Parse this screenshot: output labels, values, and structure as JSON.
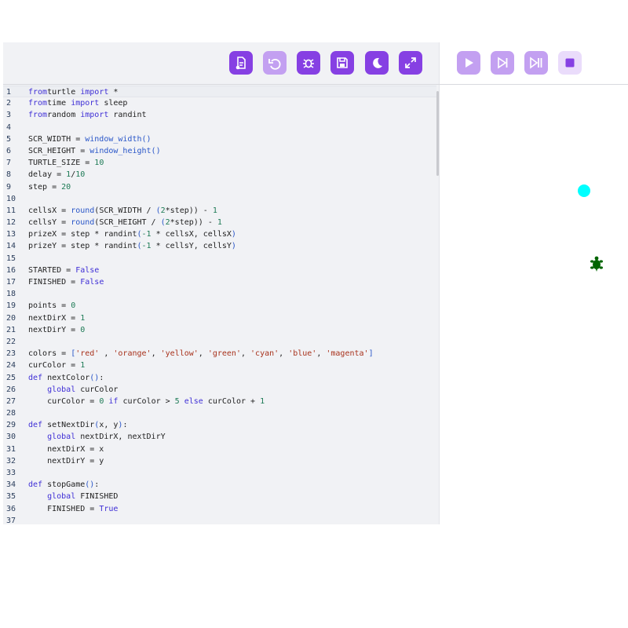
{
  "editor_toolbar": {
    "buttons": [
      {
        "name": "file-icon-button",
        "icon": "file-icon",
        "tone": "dark"
      },
      {
        "name": "undo-button",
        "icon": "undo-icon",
        "tone": "light"
      },
      {
        "name": "debug-button",
        "icon": "bug-icon",
        "tone": "dark"
      },
      {
        "name": "save-button",
        "icon": "save-icon",
        "tone": "dark"
      },
      {
        "name": "theme-button",
        "icon": "moon-icon",
        "tone": "dark"
      },
      {
        "name": "fullscreen-button",
        "icon": "expand-icon",
        "tone": "dark"
      }
    ]
  },
  "run_toolbar": {
    "buttons": [
      {
        "name": "run-button",
        "icon": "play-icon",
        "tone": "light"
      },
      {
        "name": "step-button",
        "icon": "step-icon",
        "tone": "light"
      },
      {
        "name": "continue-button",
        "icon": "step-pause-icon",
        "tone": "light"
      },
      {
        "name": "stop-button",
        "icon": "stop-icon",
        "tone": "pale"
      }
    ]
  },
  "code": {
    "active_line": 1,
    "lines": [
      [
        [
          "kw",
          "from"
        ],
        [
          "",
          "turtle "
        ],
        [
          "kw",
          "import"
        ],
        [
          "",
          " *"
        ]
      ],
      [
        [
          "kw",
          "from"
        ],
        [
          "",
          "time "
        ],
        [
          "kw",
          "import"
        ],
        [
          "",
          " sleep"
        ]
      ],
      [
        [
          "kw",
          "from"
        ],
        [
          "",
          "random "
        ],
        [
          "kw",
          "import"
        ],
        [
          "",
          " randint"
        ]
      ],
      [],
      [
        [
          "",
          "SCR_WIDTH = "
        ],
        [
          "fn",
          "window_width()"
        ]
      ],
      [
        [
          "",
          "SCR_HEIGHT = "
        ],
        [
          "fn",
          "window_height()"
        ]
      ],
      [
        [
          "",
          "TURTLE_SIZE = "
        ],
        [
          "nm",
          "10"
        ]
      ],
      [
        [
          "",
          "delay = "
        ],
        [
          "nm",
          "1"
        ],
        [
          "",
          "/"
        ],
        [
          "nm",
          "10"
        ]
      ],
      [
        [
          "",
          "step = "
        ],
        [
          "nm",
          "20"
        ]
      ],
      [],
      [
        [
          "",
          "cellsX = "
        ],
        [
          "fn",
          "round"
        ],
        [
          "",
          "(SCR_WIDTH / "
        ],
        [
          "fn",
          "("
        ],
        [
          "nm",
          "2"
        ],
        [
          "",
          "*step)) - "
        ],
        [
          "nm",
          "1"
        ]
      ],
      [
        [
          "",
          "cellsY = "
        ],
        [
          "fn",
          "round"
        ],
        [
          "",
          "(SCR_HEIGHT / "
        ],
        [
          "fn",
          "("
        ],
        [
          "nm",
          "2"
        ],
        [
          "",
          "*step)) - "
        ],
        [
          "nm",
          "1"
        ]
      ],
      [
        [
          "",
          "prizeX = step * randint"
        ],
        [
          "fn",
          "("
        ],
        [
          "nm",
          "-1"
        ],
        [
          "",
          " * cellsX, cellsX"
        ],
        [
          "fn",
          ")"
        ]
      ],
      [
        [
          "",
          "prizeY = step * randint"
        ],
        [
          "fn",
          "("
        ],
        [
          "nm",
          "-1"
        ],
        [
          "",
          " * cellsY, cellsY"
        ],
        [
          "fn",
          ")"
        ]
      ],
      [],
      [
        [
          "",
          "STARTED = "
        ],
        [
          "kw",
          "False"
        ]
      ],
      [
        [
          "",
          "FINISHED = "
        ],
        [
          "kw",
          "False"
        ]
      ],
      [],
      [
        [
          "",
          "points = "
        ],
        [
          "nm",
          "0"
        ]
      ],
      [
        [
          "",
          "nextDirX = "
        ],
        [
          "nm",
          "1"
        ]
      ],
      [
        [
          "",
          "nextDirY = "
        ],
        [
          "nm",
          "0"
        ]
      ],
      [],
      [
        [
          "",
          "colors = "
        ],
        [
          "fn",
          "["
        ],
        [
          "st",
          "'red'"
        ],
        [
          "",
          " , "
        ],
        [
          "st",
          "'orange'"
        ],
        [
          "",
          ", "
        ],
        [
          "st",
          "'yellow'"
        ],
        [
          "",
          ", "
        ],
        [
          "st",
          "'green'"
        ],
        [
          "",
          ", "
        ],
        [
          "st",
          "'cyan'"
        ],
        [
          "",
          ", "
        ],
        [
          "st",
          "'blue'"
        ],
        [
          "",
          ", "
        ],
        [
          "st",
          "'magenta'"
        ],
        [
          "fn",
          "]"
        ]
      ],
      [
        [
          "",
          "curColor = "
        ],
        [
          "nm",
          "1"
        ]
      ],
      [
        [
          "kw",
          "def"
        ],
        [
          "",
          " nextColor"
        ],
        [
          "fn",
          "()"
        ],
        [
          "",
          ":"
        ]
      ],
      [
        [
          "",
          "    "
        ],
        [
          "kw",
          "global"
        ],
        [
          "",
          " curColor"
        ]
      ],
      [
        [
          "",
          "    curColor = "
        ],
        [
          "nm",
          "0"
        ],
        [
          "",
          " "
        ],
        [
          "kw",
          "if"
        ],
        [
          "",
          " curColor > "
        ],
        [
          "nm",
          "5"
        ],
        [
          "",
          " "
        ],
        [
          "kw",
          "else"
        ],
        [
          "",
          " curColor + "
        ],
        [
          "nm",
          "1"
        ]
      ],
      [],
      [
        [
          "kw",
          "def"
        ],
        [
          "",
          " setNextDir"
        ],
        [
          "fn",
          "("
        ],
        [
          "",
          "x, y"
        ],
        [
          "fn",
          ")"
        ],
        [
          "",
          ":"
        ]
      ],
      [
        [
          "",
          "    "
        ],
        [
          "kw",
          "global"
        ],
        [
          "",
          " nextDirX, nextDirY"
        ]
      ],
      [
        [
          "",
          "    nextDirX = x"
        ]
      ],
      [
        [
          "",
          "    nextDirY = y"
        ]
      ],
      [],
      [
        [
          "kw",
          "def"
        ],
        [
          "",
          " stopGame"
        ],
        [
          "fn",
          "()"
        ],
        [
          "",
          ":"
        ]
      ],
      [
        [
          "",
          "    "
        ],
        [
          "kw",
          "global"
        ],
        [
          "",
          " FINISHED"
        ]
      ],
      [
        [
          "",
          "    FINISHED = "
        ],
        [
          "kw",
          "True"
        ]
      ],
      []
    ]
  },
  "canvas": {
    "prize_color": "#00ffff",
    "turtle_color": "#006400",
    "turtle_icon": "turtle-icon"
  },
  "colors": {
    "accent": "#8640e3",
    "accent_light": "#c3a0f1",
    "accent_pale": "#eadcfb"
  }
}
